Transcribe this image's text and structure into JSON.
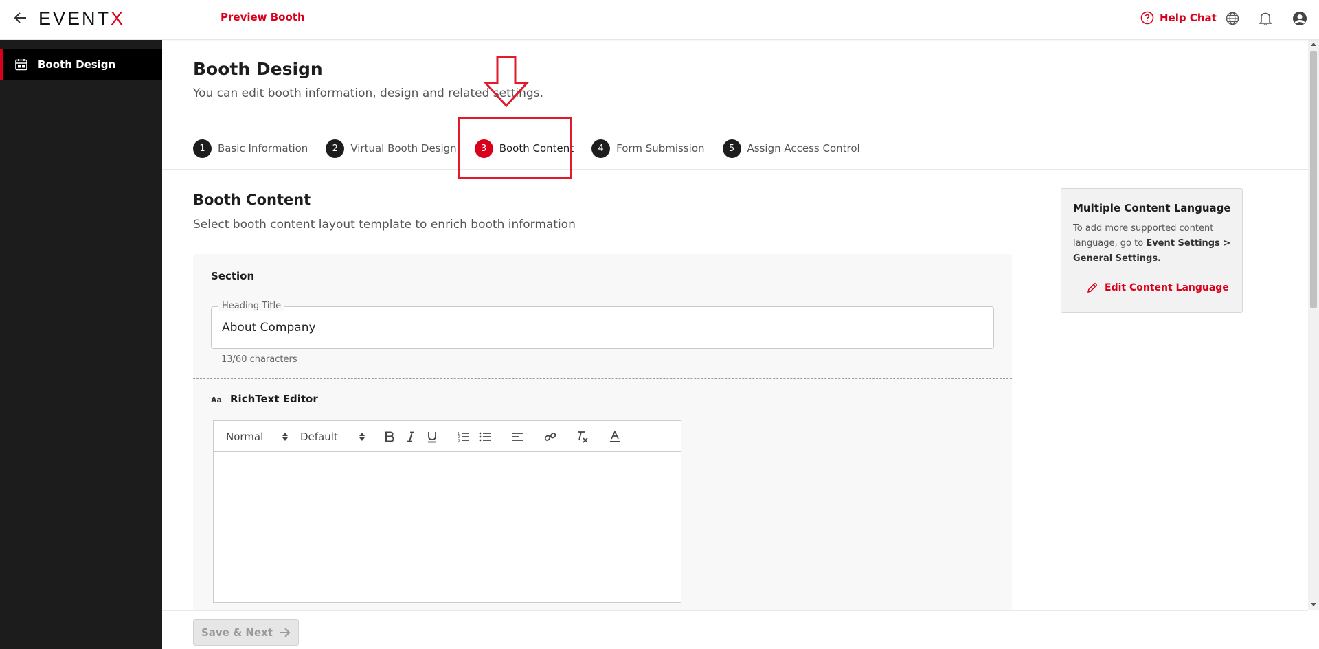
{
  "header": {
    "logo_main": "EVENT",
    "logo_accent": "X",
    "preview_label": "Preview Booth",
    "help_chat_label": "Help Chat"
  },
  "sidebar": {
    "items": [
      {
        "label": "Booth Design",
        "icon": "booth-design-icon"
      }
    ]
  },
  "page": {
    "title": "Booth Design",
    "subtitle": "You can edit booth information, design and related settings."
  },
  "steps": [
    {
      "number": "1",
      "label": "Basic Information"
    },
    {
      "number": "2",
      "label": "Virtual Booth Design"
    },
    {
      "number": "3",
      "label": "Booth Content"
    },
    {
      "number": "4",
      "label": "Form Submission"
    },
    {
      "number": "5",
      "label": "Assign Access Control"
    }
  ],
  "content": {
    "title": "Booth Content",
    "subtitle": "Select booth content layout template to enrich booth information",
    "section_label": "Section",
    "heading_field": {
      "label": "Heading Title",
      "value": "About Company",
      "char_count": "13/60 characters"
    },
    "rich_text_label": "RichText Editor",
    "toolbar": {
      "paragraph_select": "Normal",
      "font_select": "Default"
    }
  },
  "language_card": {
    "title": "Multiple Content Language",
    "text_prefix": "To add more supported content language, go to ",
    "text_bold": "Event Settings > General Settings.",
    "edit_label": "Edit Content Language"
  },
  "footer": {
    "save_label": "Save & Next"
  },
  "colors": {
    "accent": "#d9001b",
    "sidebar_bg": "#1c1c1c",
    "annotation": "#e21b2c"
  }
}
